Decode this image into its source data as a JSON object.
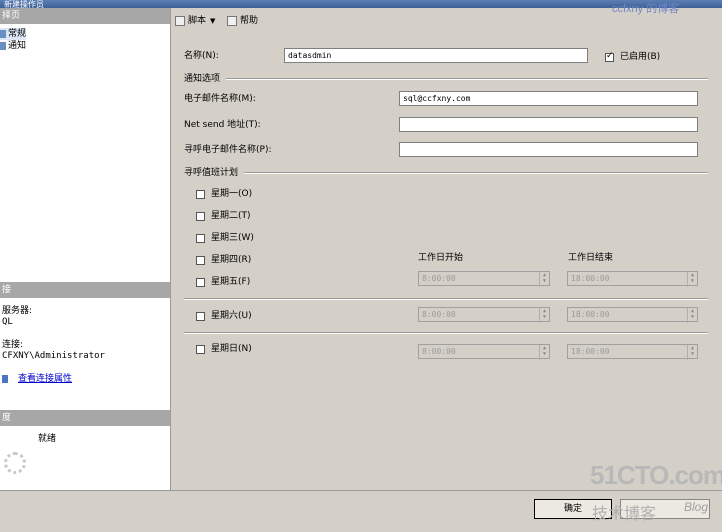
{
  "window": {
    "title": "新建操作员"
  },
  "left": {
    "select_page_header": "择页",
    "tree": [
      {
        "label": "常规",
        "selected": true
      },
      {
        "label": "通知",
        "selected": false
      }
    ],
    "connection_header": "接",
    "server_label": "服务器:",
    "server_value": "QL",
    "connection_label": "连接:",
    "connection_value": "CFXNY\\Administrator",
    "view_properties_link": "查看连接属性",
    "progress_header": "度",
    "progress_status": "就绪"
  },
  "toolbar": {
    "script_label": "脚本",
    "help_label": "帮助"
  },
  "form": {
    "name_label": "名称(N):",
    "name_value": "datasdmin",
    "enabled_label": "已启用(B)",
    "enabled_checked": true,
    "notify_section": "通知选项",
    "email_label": "电子邮件名称(M):",
    "email_value": "sql@ccfxny.com",
    "netsend_label": "Net send 地址(T):",
    "netsend_value": "",
    "pager_label": "寻呼电子邮件名称(P):",
    "pager_value": "",
    "schedule_section": "寻呼值班计划",
    "days": [
      {
        "label": "星期一(O)",
        "checked": false
      },
      {
        "label": "星期二(T)",
        "checked": false
      },
      {
        "label": "星期三(W)",
        "checked": false
      },
      {
        "label": "星期四(R)",
        "checked": false
      },
      {
        "label": "星期五(F)",
        "checked": false
      },
      {
        "label": "星期六(U)",
        "checked": false
      },
      {
        "label": "星期日(N)",
        "checked": false
      }
    ],
    "workday_start_label": "工作日开始",
    "workday_end_label": "工作日结束",
    "times": {
      "weekday_start": "8:00:00",
      "weekday_end": "18:00:00",
      "saturday_start": "8:00:00",
      "saturday_end": "18:00:00",
      "sunday_start": "8:00:00",
      "sunday_end": "18:00:00"
    }
  },
  "footer": {
    "ok_label": "确定"
  },
  "watermark": {
    "top": "ccfxny 的博客",
    "logo": "51CTO.com",
    "cn": "技术博客",
    "blog": "Blog"
  },
  "colors": {
    "header_gray": "#a7a7a7",
    "link": "#0000cc",
    "panel": "#d4d0c8"
  }
}
